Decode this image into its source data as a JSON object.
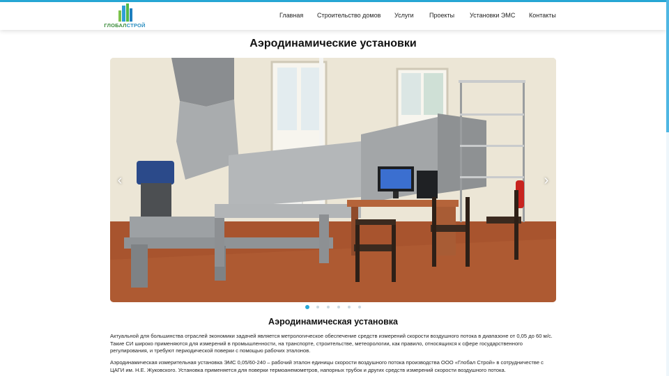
{
  "brand": {
    "logo_text_part1": "ГЛОБАЛ",
    "logo_text_part2": "СТРОЙ"
  },
  "nav": {
    "items": [
      {
        "label": "Главная"
      },
      {
        "label": "Строительство домов"
      },
      {
        "label": "Услуги"
      },
      {
        "label": "Проекты"
      },
      {
        "label": "Установки ЭМС"
      },
      {
        "label": "Контакты"
      }
    ]
  },
  "page": {
    "title": "Аэродинамические установки"
  },
  "slider": {
    "prev_icon": "chevron-left-icon",
    "next_icon": "chevron-right-icon",
    "prev_glyph": "‹",
    "next_glyph": "›",
    "slide_count": 6,
    "active_slide": 1
  },
  "article": {
    "title": "Аэродинамическая установка",
    "paragraph1": "Актуальной для большинства отраслей экономики задачей является метрологическое обеспечение средств измерений скорости воздушного потока в диапазоне от 0,05 до 60 м/с. Такие СИ широко применяются для измерений в промышленности, на транспорте, строительстве, метеорологии, как правило, относящихся к сфере государственного регулирования, и требуют периодической поверки с помощью рабочих эталонов.",
    "paragraph2": "Аэродинамическая измерительная установка ЭМС 0,05/60-240 – рабочий эталон единицы скорости воздушного потока производства ООО «Глобал Строй» в сотрудничестве с ЦАГИ им. Н.Е. Жуковского. Установка применяется для поверки термоанемометров, напорных трубок и других средств измерений скорости воздушного потока."
  },
  "colors": {
    "accent": "#27a9d8",
    "logo_green": "#3c8c3c",
    "logo_blue": "#2a8ec0"
  }
}
